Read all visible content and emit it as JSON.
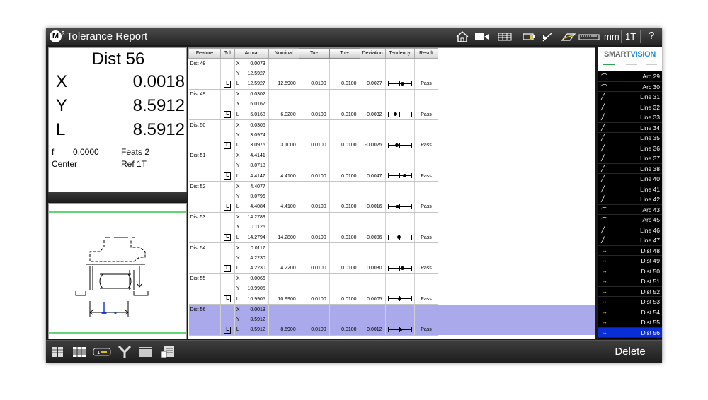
{
  "window": {
    "title": "Tolerance Report",
    "logo": "M",
    "logo_sup": "3"
  },
  "toolbar": {
    "icons": [
      "home-icon",
      "camera-icon",
      "grid-icon",
      "battery-icon",
      "edge-tool-icon",
      "probe-icon",
      "ruler-icon"
    ],
    "units": "mm",
    "tool": "1T",
    "help": "?"
  },
  "dro": {
    "title": "Dist 56",
    "axes": [
      {
        "label": "X",
        "value": "0.0018"
      },
      {
        "label": "Y",
        "value": "8.5912"
      },
      {
        "label": "L",
        "value": "8.5912"
      }
    ],
    "f_label": "f",
    "f_value": "0.0000",
    "feats": "Feats 2",
    "center": "Center",
    "ref": "Ref 1T"
  },
  "table": {
    "headers": [
      "Feature",
      "Tol",
      "Actual",
      "Nominal",
      "Tol-",
      "Tol+",
      "Deviation",
      "Tendency",
      "Result"
    ],
    "rows": [
      {
        "feature": "Dist 48",
        "x": "0.0073",
        "y": "12.5927",
        "l": "12.5927",
        "nominal": "12.5900",
        "tol_minus": "0.0100",
        "tol_plus": "0.0100",
        "deviation": "0.0027",
        "tendency": 0.27,
        "result": "Pass"
      },
      {
        "feature": "Dist 49",
        "x": "0.0302",
        "y": "6.0167",
        "l": "6.0168",
        "nominal": "6.0200",
        "tol_minus": "0.0100",
        "tol_plus": "0.0100",
        "deviation": "-0.0032",
        "tendency": -0.32,
        "result": "Pass"
      },
      {
        "feature": "Dist 50",
        "x": "0.0305",
        "y": "3.0974",
        "l": "3.0975",
        "nominal": "3.1000",
        "tol_minus": "0.0100",
        "tol_plus": "0.0100",
        "deviation": "-0.0025",
        "tendency": -0.25,
        "result": "Pass"
      },
      {
        "feature": "Dist 51",
        "x": "4.4141",
        "y": "0.0718",
        "l": "4.4147",
        "nominal": "4.4100",
        "tol_minus": "0.0100",
        "tol_plus": "0.0100",
        "deviation": "0.0047",
        "tendency": 0.47,
        "result": "Pass"
      },
      {
        "feature": "Dist 52",
        "x": "4.4077",
        "y": "0.0796",
        "l": "4.4084",
        "nominal": "4.4100",
        "tol_minus": "0.0100",
        "tol_plus": "0.0100",
        "deviation": "-0.0016",
        "tendency": -0.16,
        "result": "Pass"
      },
      {
        "feature": "Dist 53",
        "x": "14.2789",
        "y": "0.1125",
        "l": "14.2794",
        "nominal": "14.2800",
        "tol_minus": "0.0100",
        "tol_plus": "0.0100",
        "deviation": "-0.0006",
        "tendency": -0.06,
        "result": "Pass"
      },
      {
        "feature": "Dist 54",
        "x": "0.0117",
        "y": "4.2230",
        "l": "4.2230",
        "nominal": "4.2200",
        "tol_minus": "0.0100",
        "tol_plus": "0.0100",
        "deviation": "0.0030",
        "tendency": 0.3,
        "result": "Pass"
      },
      {
        "feature": "Dist 55",
        "x": "0.0066",
        "y": "10.9905",
        "l": "10.9905",
        "nominal": "10.9900",
        "tol_minus": "0.0100",
        "tol_plus": "0.0100",
        "deviation": "0.0005",
        "tendency": 0.05,
        "result": "Pass"
      },
      {
        "feature": "Dist 56",
        "x": "0.0018",
        "y": "8.5912",
        "l": "8.5912",
        "nominal": "8.5900",
        "tol_minus": "0.0100",
        "tol_plus": "0.0100",
        "deviation": "0.0012",
        "tendency": 0.12,
        "result": "Pass",
        "selected": true
      }
    ],
    "axis_labels": [
      "X",
      "Y",
      "L"
    ],
    "tol_box": "L"
  },
  "brand": {
    "smart": "SMART",
    "vision": "VISION",
    "colors": [
      "#2da44e",
      "#cccccc",
      "#cccccc"
    ]
  },
  "features": [
    {
      "name": "Arc 29",
      "type": "arc"
    },
    {
      "name": "Arc 30",
      "type": "arc"
    },
    {
      "name": "Line 31",
      "type": "line"
    },
    {
      "name": "Line 32",
      "type": "line"
    },
    {
      "name": "Line 33",
      "type": "line"
    },
    {
      "name": "Line 34",
      "type": "line"
    },
    {
      "name": "Line 35",
      "type": "line"
    },
    {
      "name": "Line 36",
      "type": "line"
    },
    {
      "name": "Line 37",
      "type": "line"
    },
    {
      "name": "Line 38",
      "type": "line"
    },
    {
      "name": "Line 40",
      "type": "line"
    },
    {
      "name": "Line 41",
      "type": "line"
    },
    {
      "name": "Line 42",
      "type": "line"
    },
    {
      "name": "Arc 43",
      "type": "arc"
    },
    {
      "name": "Arc 45",
      "type": "arc"
    },
    {
      "name": "Line 46",
      "type": "line"
    },
    {
      "name": "Line 47",
      "type": "line"
    },
    {
      "name": "Dist 48",
      "type": "dist"
    },
    {
      "name": "Dist 49",
      "type": "dist"
    },
    {
      "name": "Dist 50",
      "type": "dist"
    },
    {
      "name": "Dist 51",
      "type": "dist"
    },
    {
      "name": "Dist 52",
      "type": "dist"
    },
    {
      "name": "Dist 53",
      "type": "dist"
    },
    {
      "name": "Dist 54",
      "type": "dist"
    },
    {
      "name": "Dist 55",
      "type": "dist"
    },
    {
      "name": "Dist 56",
      "type": "dist",
      "selected": true
    }
  ],
  "bottom": {
    "icons": [
      "split-view-icon",
      "table-view-icon",
      "counter-icon",
      "filter-icon",
      "list-view-icon",
      "report-icon"
    ],
    "delete_label": "Delete"
  }
}
